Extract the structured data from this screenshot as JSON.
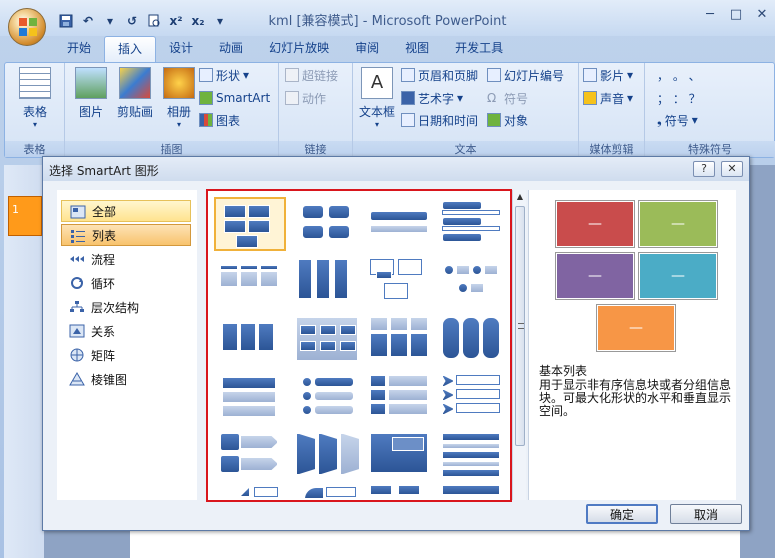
{
  "window": {
    "title": "kml [兼容模式] - Microsoft PowerPoint",
    "minimize": "─",
    "maximize": "□",
    "close": "✕"
  },
  "qat": {
    "save_icon": "save-icon",
    "undo_label": "↶",
    "redo_label": "↺",
    "superscript": "x²",
    "subscript": "x₂"
  },
  "tabs": [
    {
      "label": "开始"
    },
    {
      "label": "插入"
    },
    {
      "label": "设计"
    },
    {
      "label": "动画"
    },
    {
      "label": "幻灯片放映"
    },
    {
      "label": "审阅"
    },
    {
      "label": "视图"
    },
    {
      "label": "开发工具"
    }
  ],
  "active_tab": "插入",
  "ribbon": {
    "groups": [
      {
        "label": "表格",
        "big": "表格"
      },
      {
        "label": "插图",
        "big1": "图片",
        "big2": "剪贴画",
        "big3": "相册",
        "small1": "形状",
        "small2": "SmartArt",
        "small3": "图表"
      },
      {
        "label": "链接",
        "small1": "超链接",
        "small2": "动作"
      },
      {
        "label": "文本",
        "big": "文本框",
        "small1": "页眉和页脚",
        "small2": "艺术字",
        "small3": "日期和时间",
        "small4": "幻灯片编号",
        "small5": "符号",
        "small6": "对象"
      },
      {
        "label": "媒体剪辑",
        "small1": "影片",
        "small2": "声音"
      },
      {
        "label": "特殊符号",
        "row1": "，  。  、",
        "row2": "；  ：  ？",
        "small1": "符号"
      }
    ]
  },
  "slide_panel": {
    "slide_number": "1"
  },
  "dialog": {
    "title": "选择 SmartArt 图形",
    "help": "?",
    "close": "✕",
    "categories": [
      {
        "label": "全部"
      },
      {
        "label": "列表"
      },
      {
        "label": "流程"
      },
      {
        "label": "循环"
      },
      {
        "label": "层次结构"
      },
      {
        "label": "关系"
      },
      {
        "label": "矩阵"
      },
      {
        "label": "棱锥图"
      }
    ],
    "preview": {
      "title": "基本列表",
      "description": "用于显示非有序信息块或者分组信息块。可最大化形状的水平和垂直显示空间。",
      "shape_text": "—",
      "colors": [
        "#c94c4c",
        "#9bbb59",
        "#8064a2",
        "#4bacc6",
        "#f79646"
      ]
    },
    "ok_label": "确定",
    "cancel_label": "取消"
  }
}
